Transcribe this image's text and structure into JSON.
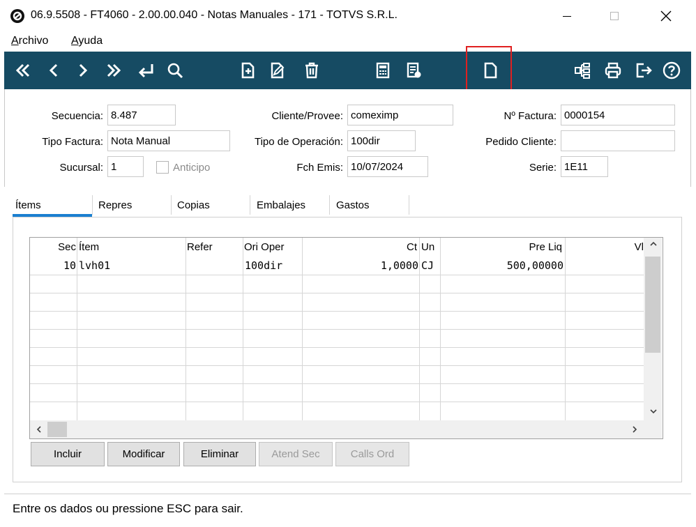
{
  "window": {
    "title": "06.9.5508 - FT4060 - 2.00.00.040 - Notas Manuales - 171 - TOTVS S.R.L.",
    "minimize": "—",
    "maximize": "☐",
    "close": "✕"
  },
  "menu": {
    "archivo_first": "A",
    "archivo_rest": "rchivo",
    "ayuda_first": "A",
    "ayuda_rest": "yuda"
  },
  "toolbar": {
    "color": "#164b63",
    "icons": [
      "first-icon",
      "prev-icon",
      "next-icon",
      "last-icon",
      "goto-icon",
      "search-icon",
      "new-icon",
      "edit-icon",
      "delete-icon",
      "calculator-icon",
      "report-icon",
      "document-icon",
      "tree-icon",
      "print-icon",
      "exit-icon",
      "help-icon"
    ]
  },
  "form": {
    "secuencia_label": "Secuencia:",
    "secuencia_value": "8.487",
    "tipo_factura_label": "Tipo Factura:",
    "tipo_factura_value": "Nota Manual",
    "sucursal_label": "Sucursal:",
    "sucursal_value": "1",
    "anticipo_label": "Anticipo",
    "cliente_label": "Cliente/Provee:",
    "cliente_value": "comeximp",
    "tipo_operacion_label": "Tipo de Operación:",
    "tipo_operacion_value": "100dir",
    "fch_emis_label": "Fch Emis:",
    "fch_emis_value": "10/07/2024",
    "nro_factura_label": "Nº Factura:",
    "nro_factura_value": "0000154",
    "pedido_cliente_label": "Pedido Cliente:",
    "pedido_cliente_value": "",
    "serie_label": "Serie:",
    "serie_value": "1E11"
  },
  "tabs": [
    {
      "label": "Ítems",
      "active": true
    },
    {
      "label": "Repres"
    },
    {
      "label": "Copias"
    },
    {
      "label": "Embalajes"
    },
    {
      "label": "Gastos"
    }
  ],
  "grid": {
    "headers": [
      "Sec",
      "Ítem",
      "Refer",
      "Ori Oper",
      "Ct",
      "Un",
      "Pre Liq",
      "Vl"
    ],
    "rows": [
      {
        "sec": "10",
        "item": "lvh01",
        "refer": "",
        "ori_oper": "100dir",
        "ct": "1,0000",
        "un": "CJ",
        "pre_liq": "500,00000",
        "vl": ""
      }
    ]
  },
  "buttons": {
    "incluir": "Incluir",
    "modificar": "Modificar",
    "eliminar": "Eliminar",
    "atend_sec": "Atend Sec",
    "calls_ord": "Calls Ord"
  },
  "status": "Entre os dados ou pressione ESC para sair."
}
